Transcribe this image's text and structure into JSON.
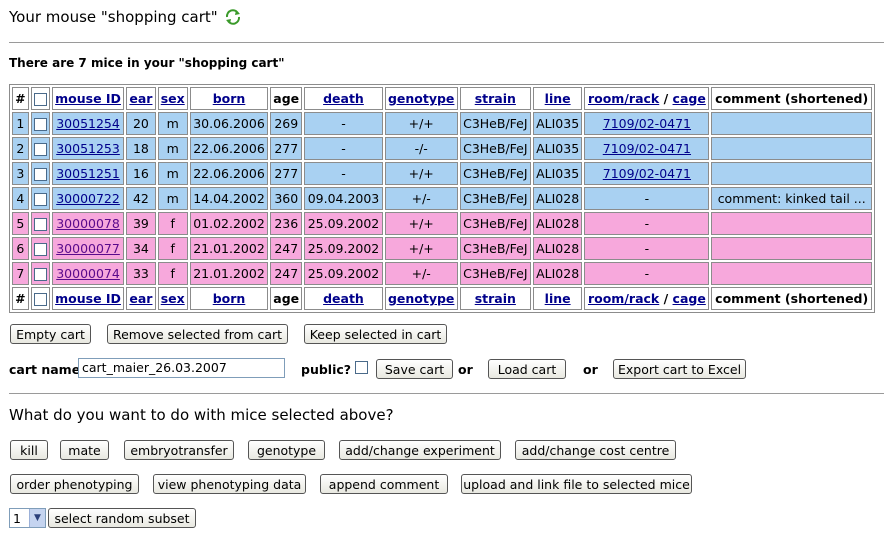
{
  "page": {
    "title": "Your mouse \"shopping cart\"",
    "count_text": "There are 7 mice in your \"shopping cart\""
  },
  "table": {
    "headers": {
      "num": "#",
      "mouse_id": "mouse ID",
      "ear": "ear",
      "sex": "sex",
      "born": "born",
      "age": "age",
      "death": "death",
      "genotype": "genotype",
      "strain": "strain",
      "line": "line",
      "room_rack": "room/rack",
      "slash": "/",
      "cage": "cage",
      "comment": "comment (shortened)"
    },
    "rows": [
      {
        "num": "1",
        "id": "30051254",
        "ear": "20",
        "sex": "m",
        "born": "30.06.2006",
        "age": "269",
        "death": "-",
        "genotype": "+/+",
        "strain": "C3HeB/FeJ",
        "line": "ALI035",
        "cage": "7109/02-0471",
        "comment": "",
        "color": "blue"
      },
      {
        "num": "2",
        "id": "30051253",
        "ear": "18",
        "sex": "m",
        "born": "22.06.2006",
        "age": "277",
        "death": "-",
        "genotype": "-/-",
        "strain": "C3HeB/FeJ",
        "line": "ALI035",
        "cage": "7109/02-0471",
        "comment": "",
        "color": "blue"
      },
      {
        "num": "3",
        "id": "30051251",
        "ear": "16",
        "sex": "m",
        "born": "22.06.2006",
        "age": "277",
        "death": "-",
        "genotype": "+/+",
        "strain": "C3HeB/FeJ",
        "line": "ALI035",
        "cage": "7109/02-0471",
        "comment": "",
        "color": "blue"
      },
      {
        "num": "4",
        "id": "30000722",
        "ear": "42",
        "sex": "m",
        "born": "14.04.2002",
        "age": "360",
        "death": "09.04.2003",
        "genotype": "+/-",
        "strain": "C3HeB/FeJ",
        "line": "ALI028",
        "cage": "-",
        "comment": "comment: kinked tail ...",
        "color": "blue"
      },
      {
        "num": "5",
        "id": "30000078",
        "ear": "39",
        "sex": "f",
        "born": "01.02.2002",
        "age": "236",
        "death": "25.09.2002",
        "genotype": "+/+",
        "strain": "C3HeB/FeJ",
        "line": "ALI028",
        "cage": "-",
        "comment": "",
        "color": "pink"
      },
      {
        "num": "6",
        "id": "30000077",
        "ear": "34",
        "sex": "f",
        "born": "21.01.2002",
        "age": "247",
        "death": "25.09.2002",
        "genotype": "+/+",
        "strain": "C3HeB/FeJ",
        "line": "ALI028",
        "cage": "-",
        "comment": "",
        "color": "pink"
      },
      {
        "num": "7",
        "id": "30000074",
        "ear": "33",
        "sex": "f",
        "born": "21.01.2002",
        "age": "247",
        "death": "25.09.2002",
        "genotype": "+/-",
        "strain": "C3HeB/FeJ",
        "line": "ALI028",
        "cage": "-",
        "comment": "",
        "color": "pink"
      }
    ]
  },
  "cart_buttons": {
    "empty": "Empty cart",
    "remove": "Remove selected from cart",
    "keep": "Keep selected in cart"
  },
  "cart_form": {
    "name_label": "cart name",
    "name_value": "cart_maier_26.03.2007",
    "public_label": "public?",
    "save": "Save cart",
    "or1": "or",
    "load": "Load cart",
    "or2": "or",
    "export": "Export cart to Excel"
  },
  "actions": {
    "heading": "What do you want to do with mice selected above?",
    "row1": [
      "kill",
      "mate",
      "embryotransfer",
      "genotype",
      "add/change experiment",
      "add/change cost centre"
    ],
    "row2": [
      "order phenotyping",
      "view phenotyping data",
      "append comment",
      "upload and link file to selected mice"
    ],
    "subset_value": "1",
    "subset_button": "select random subset"
  },
  "colors": {
    "male_row": "#a9d1f2",
    "female_row": "#f7a8dc",
    "link": "#00008b"
  }
}
